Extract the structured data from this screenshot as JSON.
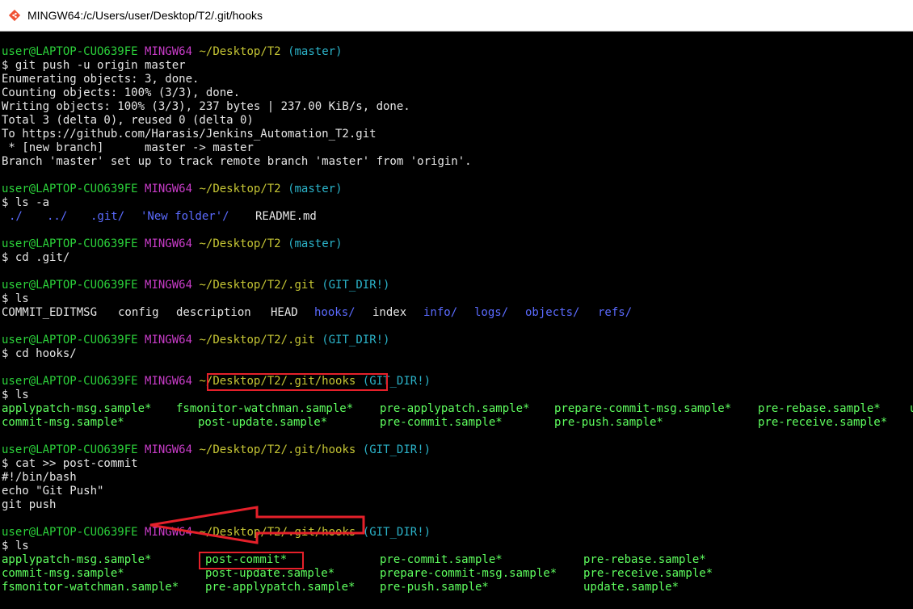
{
  "window": {
    "title": "MINGW64:/c/Users/user/Desktop/T2/.git/hooks"
  },
  "colors": {
    "user": "#2bd13a",
    "mingw": "#c83cc8",
    "path": "#c5c534",
    "branch": "#2bb3c9",
    "dir": "#5b6bff",
    "exec": "#5fff5f",
    "highlight": "#e5202a"
  },
  "prompt": {
    "user": "user@LAPTOP-CUO639FE",
    "sys": "MINGW64",
    "path_t2": "~/Desktop/T2",
    "path_git": "~/Desktop/T2/.git",
    "path_hooks": "~/Desktop/T2/.git/hooks",
    "branch_master": "(master)",
    "branch_gitdir": "(GIT_DIR!)"
  },
  "block1": {
    "cmd": "$ git push -u origin master",
    "out": [
      "Enumerating objects: 3, done.",
      "Counting objects: 100% (3/3), done.",
      "Writing objects: 100% (3/3), 237 bytes | 237.00 KiB/s, done.",
      "Total 3 (delta 0), reused 0 (delta 0)",
      "To https://github.com/Harasis/Jenkins_Automation_T2.git",
      " * [new branch]      master -> master",
      "Branch 'master' set up to track remote branch 'master' from 'origin'."
    ]
  },
  "block2": {
    "cmd": "$ ls -a",
    "items": [
      "./",
      "../",
      ".git/",
      "'New folder'/",
      "README.md"
    ]
  },
  "block3": {
    "cmd": "$ cd .git/"
  },
  "block4": {
    "cmd": "$ ls",
    "items": [
      "COMMIT_EDITMSG",
      "config",
      "description",
      "HEAD",
      "hooks/",
      "index",
      "info/",
      "logs/",
      "objects/",
      "refs/"
    ]
  },
  "block5": {
    "cmd": "$ cd hooks/"
  },
  "block6": {
    "cmd": "$ ls",
    "row1": [
      "applypatch-msg.sample*",
      "fsmonitor-watchman.sample*",
      "pre-applypatch.sample*",
      "prepare-commit-msg.sample*",
      "pre-rebase.sample*",
      "u"
    ],
    "row2": [
      "commit-msg.sample*",
      "post-update.sample*",
      "pre-commit.sample*",
      "pre-push.sample*",
      "pre-receive.sample*"
    ]
  },
  "block7": {
    "cmd": "$ cat >> post-commit",
    "lines": [
      "#!/bin/bash",
      "echo \"Git Push\"",
      "git push"
    ]
  },
  "block8": {
    "cmd": "$ ls",
    "row1": [
      "applypatch-msg.sample*",
      "post-commit*",
      "pre-commit.sample*",
      "pre-rebase.sample*"
    ],
    "row2": [
      "commit-msg.sample*",
      "post-update.sample*",
      "prepare-commit-msg.sample*",
      "pre-receive.sample*"
    ],
    "row3": [
      "fsmonitor-watchman.sample*",
      "pre-applypatch.sample*",
      "pre-push.sample*",
      "update.sample*"
    ]
  }
}
